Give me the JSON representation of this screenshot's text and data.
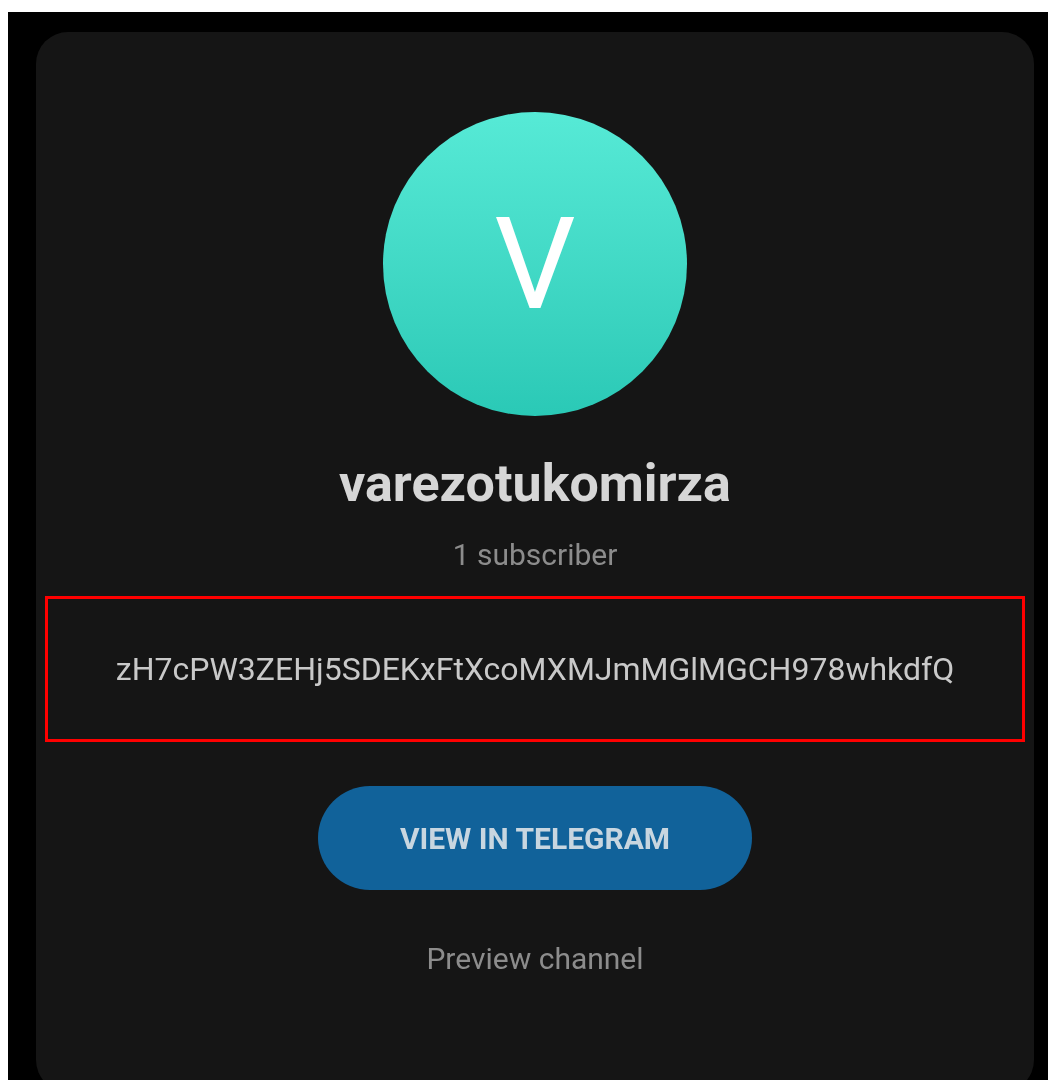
{
  "channel": {
    "avatar_letter": "V",
    "name": "varezotukomirza",
    "subscribers": "1 subscriber",
    "description": "zH7cPW3ZEHj5SDEKxFtXcoMXMJmMGlMGCH978whkdfQ"
  },
  "buttons": {
    "primary": "VIEW IN TELEGRAM",
    "link": "Preview channel"
  }
}
